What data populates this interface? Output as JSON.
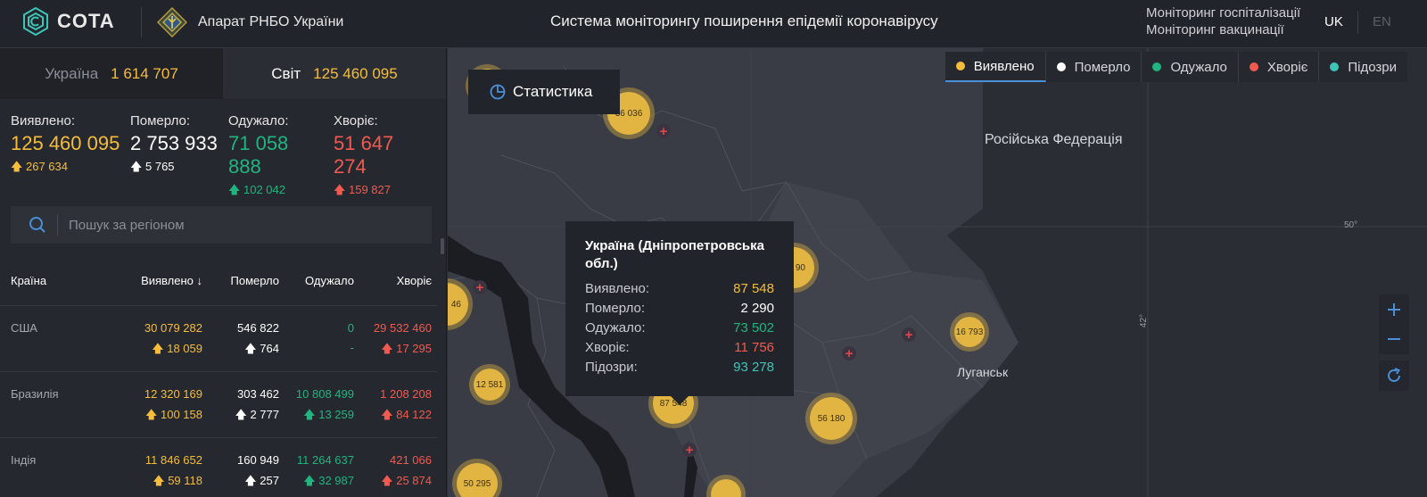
{
  "header": {
    "logo_text": "COTA",
    "org_name": "Апарат РНБО України",
    "title": "Система моніторингу поширення епідемії коронавірусу",
    "links": [
      "Моніторинг госпіталізації",
      "Моніторинг вакцинації"
    ],
    "lang_uk": "UK",
    "lang_en": "EN"
  },
  "tabs": {
    "ukraine_label": "Україна",
    "ukraine_value": "1 614 707",
    "world_label": "Світ",
    "world_value": "125 460 095"
  },
  "stats": {
    "detected": {
      "label": "Виявлено:",
      "value": "125 460 095",
      "delta": "267 634"
    },
    "died": {
      "label": "Померло:",
      "value": "2 753 933",
      "delta": "5 765"
    },
    "recovered": {
      "label": "Одужало:",
      "value": "71 058 888",
      "delta": "102 042"
    },
    "sick": {
      "label": "Хворіє:",
      "value": "51 647 274",
      "delta": "159 827"
    }
  },
  "search": {
    "placeholder": "Пошук за регіоном"
  },
  "table": {
    "headers": {
      "country": "Країна",
      "detected": "Виявлено",
      "died": "Померло",
      "recovered": "Одужало",
      "sick": "Хворіє"
    },
    "rows": [
      {
        "country": "США",
        "detected": "30 079 282",
        "detected_delta": "18 059",
        "died": "546 822",
        "died_delta": "764",
        "recovered": "0",
        "recovered_delta": "-",
        "sick": "29 532 460",
        "sick_delta": "17 295"
      },
      {
        "country": "Бразилія",
        "detected": "12 320 169",
        "detected_delta": "100 158",
        "died": "303 462",
        "died_delta": "2 777",
        "recovered": "10 808 499",
        "recovered_delta": "13 259",
        "sick": "1 208 208",
        "sick_delta": "84 122"
      },
      {
        "country": "Індія",
        "detected": "11 846 652",
        "detected_delta": "59 118",
        "died": "160 949",
        "died_delta": "257",
        "recovered": "11 264 637",
        "recovered_delta": "32 987",
        "sick": "421 066",
        "sick_delta": "25 874"
      }
    ]
  },
  "legend": [
    {
      "label": "Виявлено",
      "color": "#f5bd3b"
    },
    {
      "label": "Померло",
      "color": "#ffffff"
    },
    {
      "label": "Одужало",
      "color": "#21b47e"
    },
    {
      "label": "Хворіє",
      "color": "#f05a4f"
    },
    {
      "label": "Підозри",
      "color": "#3fc4b8"
    }
  ],
  "map": {
    "stat_button": "Статистика",
    "labels": {
      "russia": "Російська Федерація",
      "luhansk": "Луганськ"
    },
    "grid": {
      "lat": "50°",
      "lon": "42°"
    },
    "clusters": {
      "c1": "36 036",
      "c2": "87 548",
      "c3": "12 581",
      "c4": "56 180",
      "c5": "16 793",
      "c6": "50 295",
      "c7": "90",
      "c8": "46"
    }
  },
  "tooltip": {
    "title": "Україна (Дніпропетровська обл.)",
    "rows": [
      {
        "label": "Виявлено:",
        "value": "87 548"
      },
      {
        "label": "Померло:",
        "value": "2 290"
      },
      {
        "label": "Одужало:",
        "value": "73 502"
      },
      {
        "label": "Хворіє:",
        "value": "11 756"
      },
      {
        "label": "Підозри:",
        "value": "93 278"
      }
    ]
  }
}
